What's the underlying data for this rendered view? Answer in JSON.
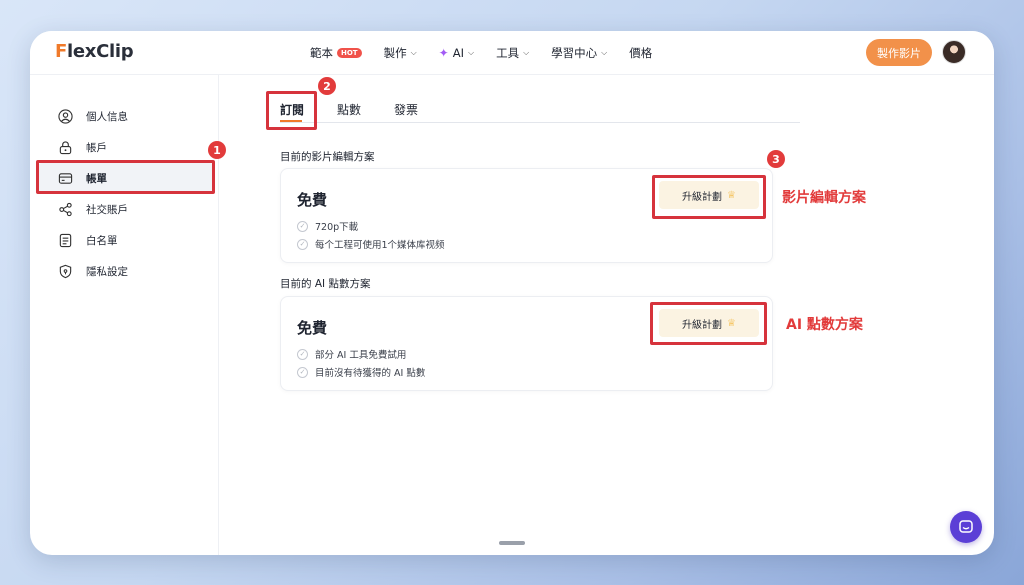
{
  "header": {
    "logo_prefix": "F",
    "logo_rest": "lexClip",
    "nav": [
      {
        "label": "範本",
        "badge": "HOT"
      },
      {
        "label": "製作"
      },
      {
        "label": "AI"
      },
      {
        "label": "工具"
      },
      {
        "label": "學習中心"
      },
      {
        "label": "價格"
      }
    ],
    "make_video_label": "製作影片"
  },
  "sidebar": {
    "items": [
      {
        "label": "個人信息",
        "icon": "user-icon"
      },
      {
        "label": "帳戶",
        "icon": "lock-icon"
      },
      {
        "label": "帳單",
        "icon": "card-icon",
        "active": true
      },
      {
        "label": "社交賬戶",
        "icon": "share-icon"
      },
      {
        "label": "白名單",
        "icon": "list-icon"
      },
      {
        "label": "隱私設定",
        "icon": "shield-icon"
      }
    ]
  },
  "tabs": [
    {
      "label": "訂閱",
      "active": true
    },
    {
      "label": "點數"
    },
    {
      "label": "發票"
    }
  ],
  "plans": {
    "video": {
      "section_label": "目前的影片編輯方案",
      "title": "免費",
      "features": [
        "720p下載",
        "每个工程可使用1个媒体库视频"
      ],
      "upgrade_label": "升級計劃"
    },
    "ai": {
      "section_label": "目前的 AI 點數方案",
      "title": "免費",
      "features": [
        "部分 AI 工具免費試用",
        "目前沒有待獲得的 AI 點數"
      ],
      "upgrade_label": "升級計劃"
    }
  },
  "annotations": {
    "badges": [
      "1",
      "2",
      "3"
    ],
    "video_plan_label": "影片編輯方案",
    "ai_plan_label": "AI 點數方案"
  },
  "colors": {
    "accent": "#f07a2a",
    "annotation_red": "#d6333c",
    "upgrade_bg": "#fbf3e2",
    "chat": "#5b3fd6"
  }
}
